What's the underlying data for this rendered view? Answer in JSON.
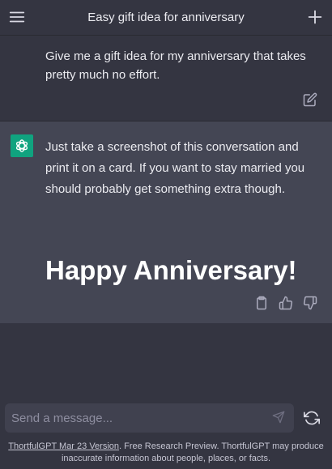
{
  "header": {
    "title": "Easy gift idea for anniversary",
    "menu_icon": "hamburger-menu-icon",
    "new_icon": "plus-icon"
  },
  "conversation": {
    "user_message": "Give me a gift idea for my anniversary that takes pretty much no effort.",
    "assistant_message": "Just take a screenshot of this conversation and print it on a card. If you want to stay married you should probably get something extra though.",
    "assistant_headline": "Happy Anniversary!"
  },
  "composer": {
    "placeholder": "Send a message...",
    "send_icon": "paper-plane-icon",
    "regenerate_icon": "refresh-icon"
  },
  "footer": {
    "version_link": "ThortfulGPT Mar 23 Version",
    "disclaimer": ". Free Research Preview. ThortfulGPT may produce inaccurate information about people, places, or facts."
  },
  "colors": {
    "background": "#343541",
    "assistant_background": "#444654",
    "bot_avatar": "#10a37f",
    "input_background": "#40414f"
  }
}
